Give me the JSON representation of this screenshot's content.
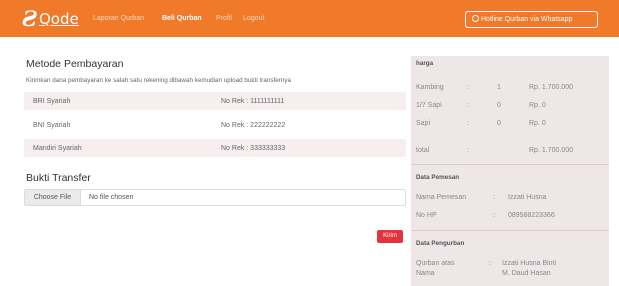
{
  "navbar": {
    "brand": "Qode",
    "links": [
      "Laporan Qurban",
      "Beli Qurban",
      "Profil",
      "Logout"
    ],
    "whatsapp_button": "Hotline Qurban via Whatsapp",
    "colors": {
      "bg": "#f07a2a",
      "active_link": "#ffffff",
      "inactive_link": "#ffd9bd"
    }
  },
  "payment": {
    "title": "Metode Pembayaran",
    "instruction": "Kirimkan dana pembayaran ke salah satu rekening dibawah kemudian upload bukti transfernya",
    "banks": [
      {
        "name": "BRI Syariah",
        "rek": "No Rek : 1111111111"
      },
      {
        "name": "BNI Syariah",
        "rek": "No Rek : 222222222"
      },
      {
        "name": "Mandiri Syariah",
        "rek": "No Rek : 333333333"
      }
    ]
  },
  "upload": {
    "title": "Bukti Transfer",
    "choose_label": "Choose File",
    "status": "No file chosen"
  },
  "submit_label": "Kirim",
  "side": {
    "harga": {
      "heading": "harga",
      "rows": [
        {
          "item": "Kambing",
          "sep": ":",
          "qty": "1",
          "price": "Rp. 1.700.000"
        },
        {
          "item": "1/7 Sapi",
          "sep": ":",
          "qty": "0",
          "price": "Rp. 0"
        },
        {
          "item": "Sapi",
          "sep": ":",
          "qty": "0",
          "price": "Rp. 0"
        }
      ],
      "total": {
        "label": "total",
        "sep": ":",
        "value": "Rp. 1.700.000"
      }
    },
    "pemesan": {
      "heading": "Data Pemesan",
      "rows": [
        {
          "label": "Nama Pemesan",
          "sep": ":",
          "value": "Izzati Husna"
        },
        {
          "label": "No HP",
          "sep": ":",
          "value": "089588223366"
        }
      ]
    },
    "pengurban": {
      "heading": "Data Pengurban",
      "label_line1": "Qurban atas",
      "label_line2": "Nama",
      "sep": ":",
      "value_line1": "Izzati Husna Binti",
      "value_line2": "M. Daud Hasan"
    }
  }
}
